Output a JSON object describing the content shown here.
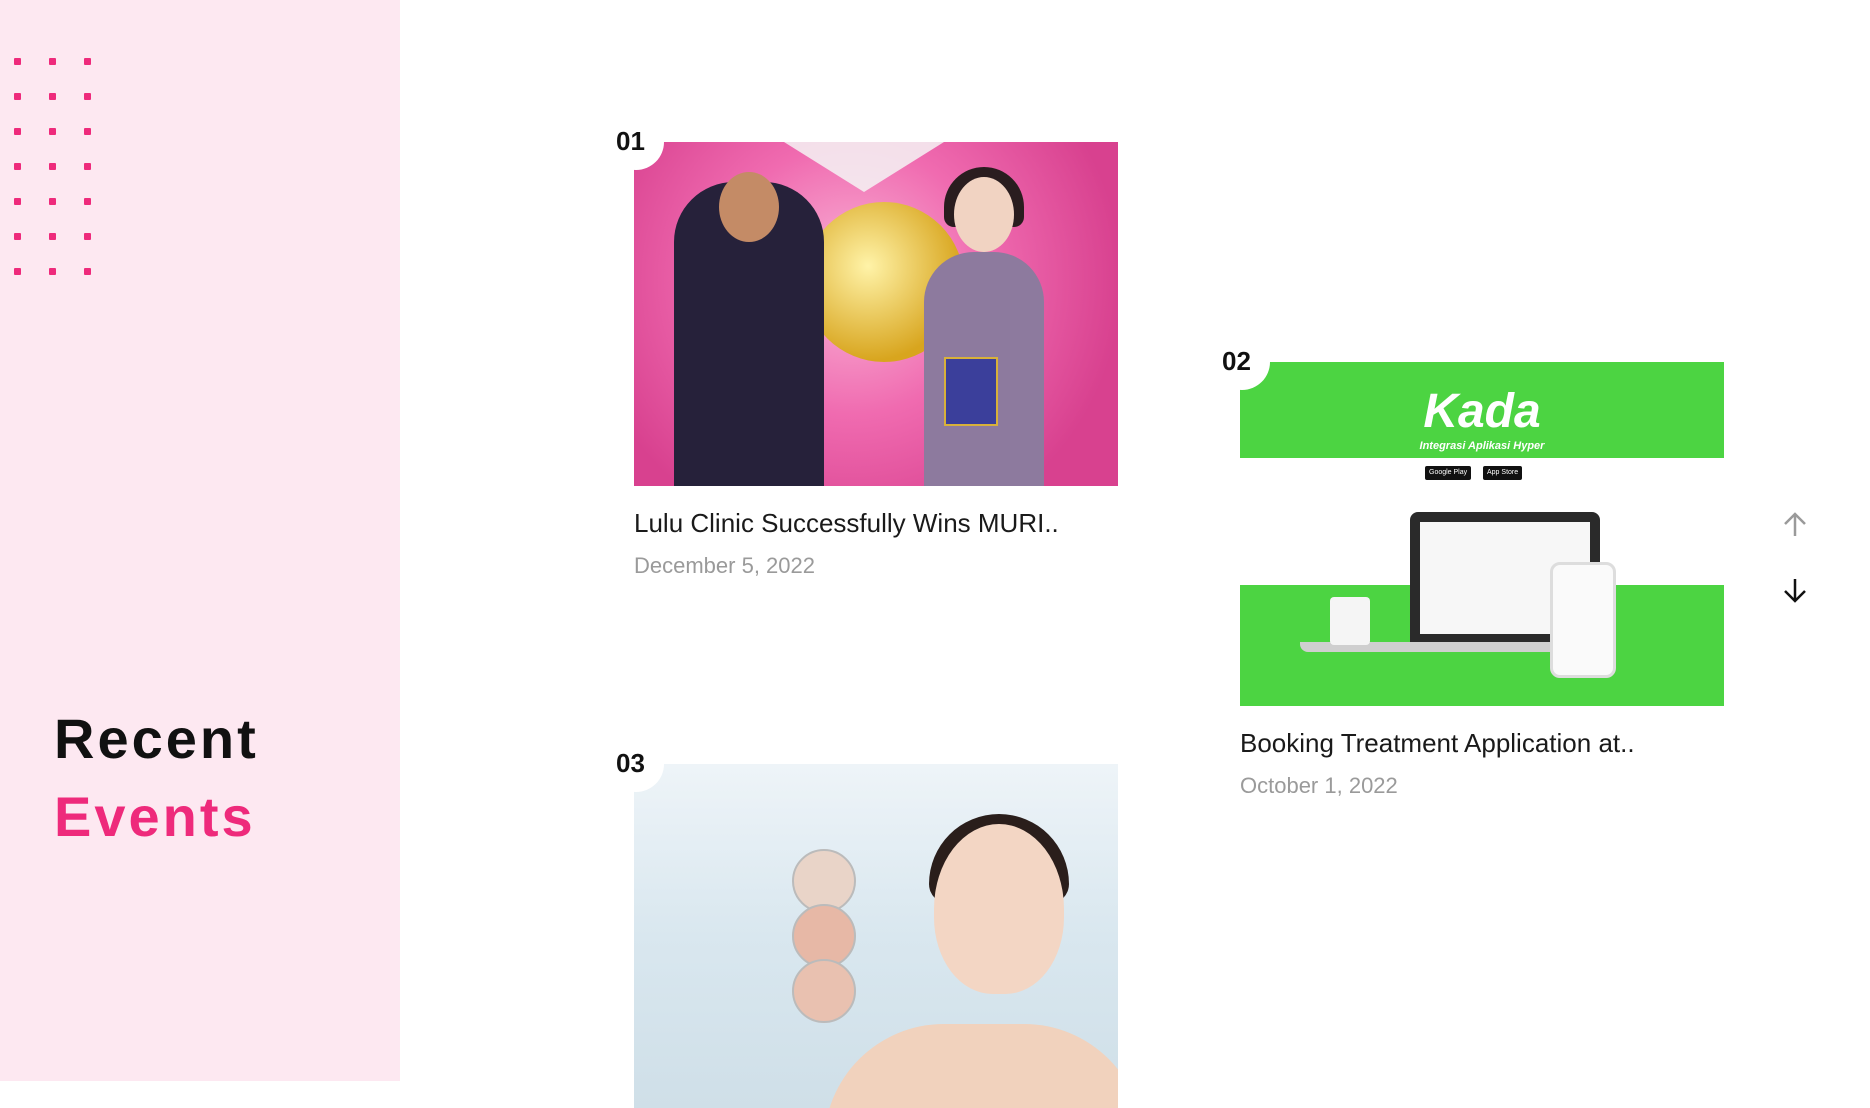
{
  "sidebar": {
    "heading_line1": "Recent",
    "heading_line2": "Events",
    "accent_color": "#ee2a7b",
    "background_color": "#fde8f1"
  },
  "events": [
    {
      "number": "01",
      "title": "Lulu Clinic Successfully Wins MURI..",
      "date": "December 5, 2022",
      "image": "award-ceremony-photo"
    },
    {
      "number": "02",
      "title": "Booking Treatment Application at..",
      "date": "October 1, 2022",
      "image": "kada-app-promo",
      "brand": "Kada",
      "tagline": "Integrasi Aplikasi Hyper",
      "store_badges": [
        "Google Play",
        "App Store"
      ]
    },
    {
      "number": "03",
      "title": "",
      "date": "",
      "image": "acne-skin-photo"
    }
  ],
  "nav": {
    "up_icon": "arrow-up-icon",
    "down_icon": "arrow-down-icon"
  }
}
